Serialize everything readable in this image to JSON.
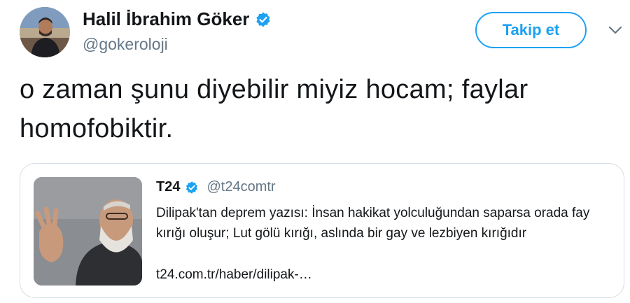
{
  "author": {
    "name": "Halil İbrahim Göker",
    "handle": "@gokeroloji",
    "verified": true
  },
  "actions": {
    "follow_label": "Takip et",
    "menu_icon": "chevron-down-icon"
  },
  "tweet": {
    "text": "o zaman şunu diyebilir miyiz hocam; faylar homofobiktir."
  },
  "quoted_tweet": {
    "name": "T24",
    "handle": "@t24comtr",
    "verified": true,
    "text": "Dilipak'tan deprem yazısı: İnsan hakikat yolculuğundan saparsa orada fay kırığı oluşur; Lut gölü kırığı, aslında bir gay ve lezbiyen kırığıdır",
    "link": "t24.com.tr/haber/dilipak-…"
  },
  "colors": {
    "accent": "#1da1f2",
    "text": "#14171a",
    "secondary": "#657786",
    "border": "#d6dde3"
  }
}
